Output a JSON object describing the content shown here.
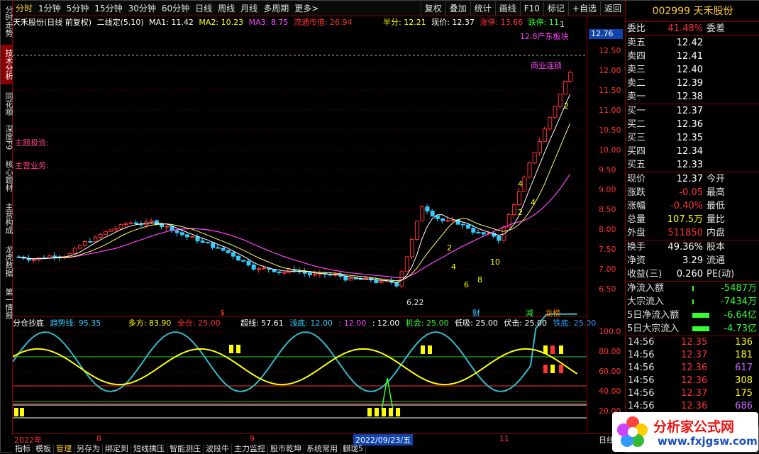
{
  "topbar": {
    "tabs": [
      "分时",
      "1分钟",
      "5分钟",
      "15分钟",
      "30分钟",
      "60分钟",
      "日线",
      "周线",
      "月线",
      "多周期",
      "更多>"
    ],
    "right_tabs": [
      "复权",
      "叠加",
      "统计",
      "画线",
      "F10",
      "标记",
      "+自选",
      "返回"
    ]
  },
  "leftbar": {
    "items": [
      "分时走势",
      "技术分析",
      "同花顺",
      "深度F9",
      "核心题材",
      "主营构成",
      "龙虎数据",
      "第一情报"
    ]
  },
  "chart_info": {
    "name": "天禾股份(日线 前复权)",
    "indicator": "二线定(5,10)",
    "ma1": "MA1: 11.42",
    "ma2": "MA2: 10.23",
    "ma3": "MA3: 8.75",
    "float": "流通市值: 26.94",
    "half": "半分: 12.21",
    "price": "现价: 12.37",
    "limit_up": "涨停: 13.66",
    "limit_down": "跌停: 11."
  },
  "main_labels": {
    "theme": "主题投资:",
    "business": "主营业务:",
    "high_label": "12.8产东板块",
    "biz_link": "商业连锁",
    "low_label": "6.22",
    "cai": "财",
    "jian": "减",
    "longhu": "龙榜",
    "dollar": "$",
    "marker_2a": "2",
    "marker_2b": "2",
    "marker_2c": "2",
    "marker_4a": "4",
    "marker_4b": "4",
    "marker_4c": "4",
    "marker_6": "6",
    "marker_8": "8",
    "marker_10": "10",
    "marker_1": "1"
  },
  "yaxis_main": [
    "12.50",
    "12.00",
    "11.50",
    "11.00",
    "10.50",
    "10.00",
    "9.50",
    "9.00",
    "8.50",
    "8.00",
    "7.50",
    "7.00",
    "6.50"
  ],
  "current_price_tag": "12.76",
  "subchart": {
    "name": "分仓抄底",
    "trend": "趋势线: 95.35",
    "bull": "多方: 83.90",
    "full": "全仓: 25.00",
    "super": "超线: 57.61",
    "shallow": "浅底: 12.00",
    "v1": ": 12.00",
    "v2": ": 12.00",
    "chance": "机会: 25.00",
    "lowbuy": "低吸: 25.00",
    "crouch": "伏击: 25.00",
    "iron": "铁底: 25.00",
    "yaxis": [
      "100.0",
      "80.00",
      "60.00",
      "40.00",
      "20.00"
    ]
  },
  "datebar": {
    "year": "2022年",
    "m8": "8",
    "m9": "9",
    "date": "2022/09/23/五",
    "m11": "11",
    "right": "日线"
  },
  "bottom_tabs": [
    "指标",
    "模板",
    "管理",
    "另存为",
    "绑定到",
    "短线擒压",
    "智能测庄",
    "波段牛",
    "主力监控",
    "股市乾坤",
    "系统常用",
    "麒珑5"
  ],
  "quote": {
    "code": "002999",
    "name": "天禾股份",
    "ratio_label": "委比",
    "ratio": "41.48%",
    "diff_label": "委差",
    "asks": [
      {
        "label": "卖五",
        "price": "12.42"
      },
      {
        "label": "卖四",
        "price": "12.41"
      },
      {
        "label": "卖三",
        "price": "12.40"
      },
      {
        "label": "卖二",
        "price": "12.39"
      },
      {
        "label": "卖一",
        "price": "12.38"
      }
    ],
    "bids": [
      {
        "label": "买一",
        "price": "12.37"
      },
      {
        "label": "买二",
        "price": "12.36"
      },
      {
        "label": "买三",
        "price": "12.35"
      },
      {
        "label": "买四",
        "price": "12.34"
      },
      {
        "label": "买五",
        "price": "12.33"
      }
    ],
    "stats": [
      {
        "k": "现价",
        "v": "12.37",
        "k2": "今开"
      },
      {
        "k": "涨跌",
        "v": "-0.05",
        "k2": "最高"
      },
      {
        "k": "涨幅",
        "v": "-0.40%",
        "k2": "最低"
      },
      {
        "k": "总量",
        "v": "107.5万",
        "k2": "量比"
      },
      {
        "k": "外盘",
        "v": "511850",
        "k2": "内盘"
      }
    ],
    "stats2": [
      {
        "k": "换手",
        "v": "49.36%",
        "k2": "股本"
      },
      {
        "k": "净资",
        "v": "3.29",
        "k2": "流通"
      },
      {
        "k": "收益(三)",
        "v": "0.260",
        "k2": "PE(动)"
      }
    ],
    "flows": [
      {
        "k": "净流入额",
        "v": "-5487万"
      },
      {
        "k": "大宗流入",
        "v": "-7434万"
      },
      {
        "k": "5日净流入额",
        "v": "-6.64亿"
      },
      {
        "k": "5日大宗流入",
        "v": "-4.73亿"
      }
    ],
    "ticks": [
      {
        "t": "14:56",
        "p": "12.35",
        "v": "136"
      },
      {
        "t": "14:56",
        "p": "12.37",
        "v": "181"
      },
      {
        "t": "14:56",
        "p": "12.36",
        "v": "617"
      },
      {
        "t": "14:56",
        "p": "12.36",
        "v": "308"
      },
      {
        "t": "14:56",
        "p": "12.37",
        "v": "175"
      },
      {
        "t": "14:56",
        "p": "12.36",
        "v": "686"
      }
    ]
  },
  "logo": {
    "name": "分析家公式网",
    "url": "www.fxjgsw.com"
  }
}
